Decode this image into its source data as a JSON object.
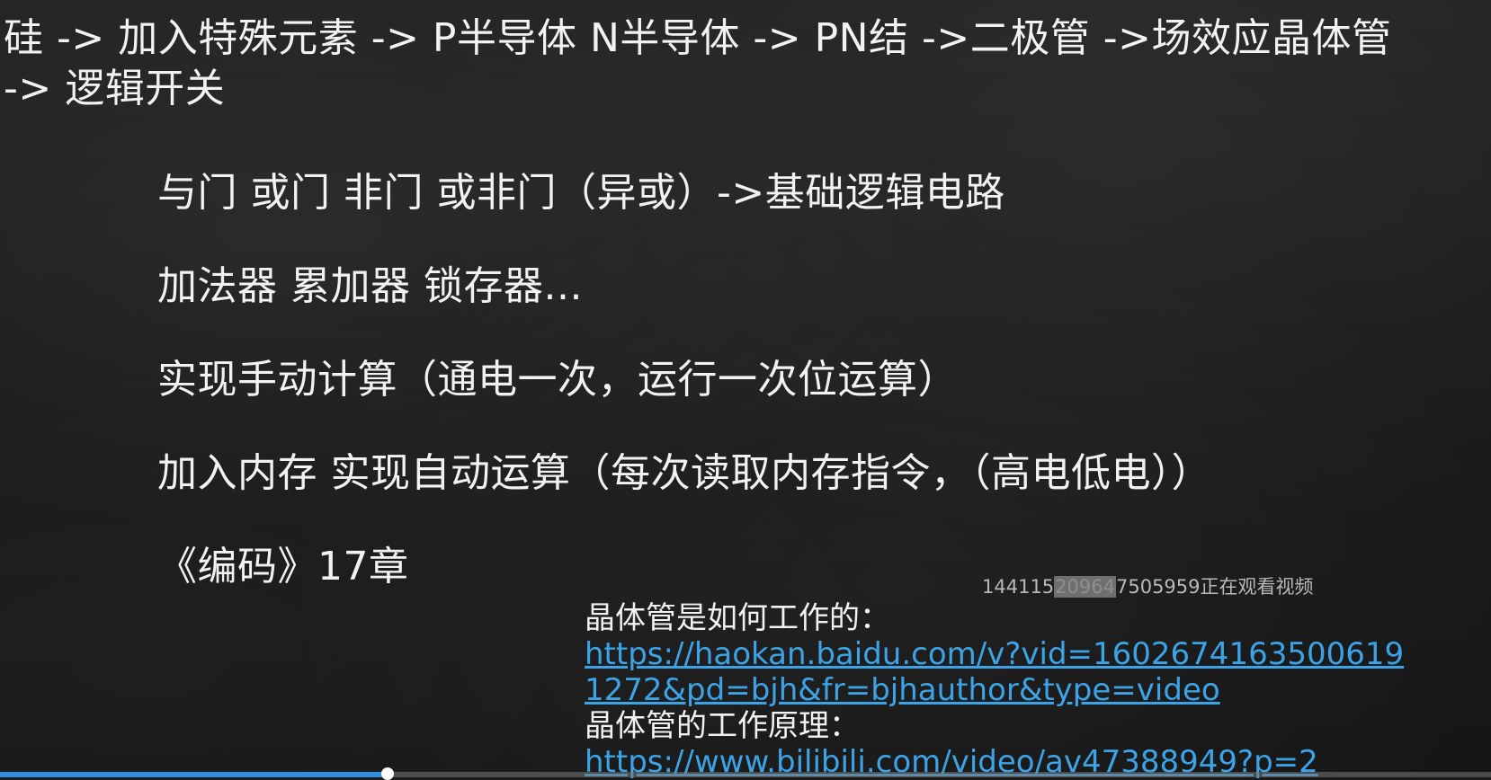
{
  "slide": {
    "top_line_1": "硅 -> 加入特殊元素 -> P半导体 N半导体 -> PN结 ->二极管 ->场效应晶体管",
    "top_line_2": "-> 逻辑开关",
    "items": [
      "与门 或门 非门 或非门（异或）->基础逻辑电路",
      "加法器 累加器 锁存器...",
      "实现手动计算（通电一次，运行一次位运算）",
      "加入内存 实现自动运算（每次读取内存指令，（高电低电））",
      "《编码》17章"
    ],
    "links": [
      {
        "label": "晶体管是如何工作的：",
        "url": "https://haokan.baidu.com/v?vid=16026741635006191272&pd=bjh&fr=bjhauthor&type=video"
      },
      {
        "label": "晶体管的工作原理：",
        "url": "https://www.bilibili.com/video/av47388949?p=2"
      }
    ]
  },
  "watermark": {
    "prefix": "144115",
    "masked": "20964",
    "suffix": "7505959正在观看视频"
  },
  "player": {
    "progress": 0.26,
    "accent_color": "#2e8fe0",
    "link_color": "#3ba3e6"
  }
}
